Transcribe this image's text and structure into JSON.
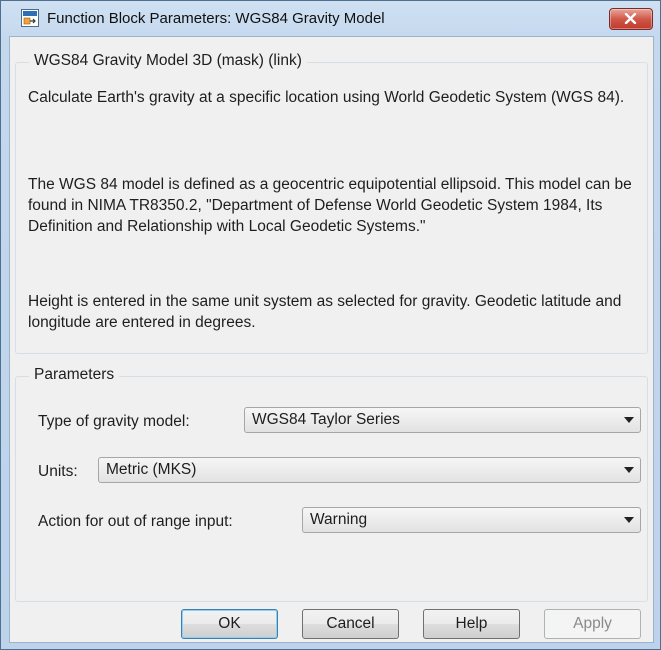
{
  "window": {
    "title": "Function Block Parameters: WGS84 Gravity Model",
    "icon": "simulink-block-icon",
    "close_icon": "close-icon"
  },
  "description_group": {
    "title": "WGS84 Gravity Model 3D (mask) (link)",
    "paragraph_1": "Calculate Earth's gravity at a specific location using World Geodetic System (WGS 84).",
    "paragraph_2": "The WGS 84 model is defined as a geocentric equipotential ellipsoid. This model can be found in NIMA TR8350.2,  \"Department of Defense World Geodetic System 1984, Its Definition and Relationship with Local Geodetic Systems.\"",
    "paragraph_3": "Height is entered in the same unit system as selected for gravity. Geodetic latitude and longitude are entered in degrees."
  },
  "parameters": {
    "title": "Parameters",
    "gravity_model_label": "Type of gravity model:",
    "gravity_model_value": "WGS84 Taylor Series",
    "units_label": "Units:",
    "units_value": "Metric (MKS)",
    "out_of_range_label": "Action for out of range input:",
    "out_of_range_value": "Warning"
  },
  "buttons": {
    "ok": "OK",
    "cancel": "Cancel",
    "help": "Help",
    "apply": "Apply"
  }
}
